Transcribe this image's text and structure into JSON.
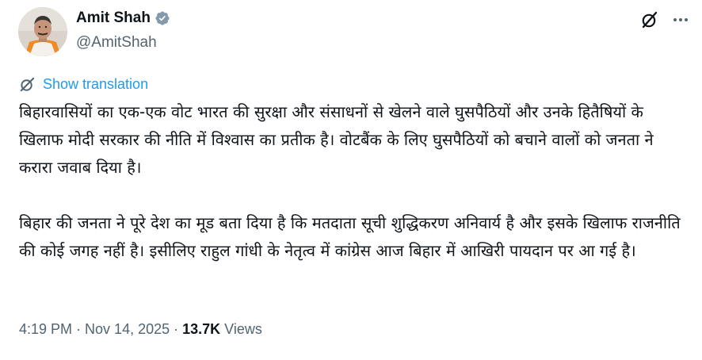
{
  "author": {
    "name": "Amit Shah",
    "handle": "@AmitShah",
    "avatar_icon": "profile-photo",
    "verified_icon": "verified-badge-icon",
    "verified_color": "#829aab"
  },
  "actions": {
    "grok_icon": "grok-icon",
    "more_icon": "more-horizontal-icon"
  },
  "translation": {
    "icon": "translate-icon",
    "label": "Show translation",
    "color": "#1d9bf0"
  },
  "tweet": {
    "paragraphs": [
      "बिहारवासियों का एक-एक वोट भारत की सुरक्षा और संसाधनों से खेलने वाले घुसपैठियों और उनके हितैषियों के खिलाफ मोदी सरकार की नीति में विश्वास का प्रतीक है। वोटबैंक के लिए घुसपैठियों को बचाने वालों को जनता ने करारा जवाब दिया है।",
      "बिहार की जनता ने पूरे देश का मूड बता दिया है कि मतदाता सूची शुद्धिकरण अनिवार्य है और इसके खिलाफ राजनीति की कोई जगह नहीं है। इसीलिए राहुल गांधी के नेतृत्व में कांग्रेस आज बिहार में आखिरी पायदान पर आ गई है।"
    ]
  },
  "meta": {
    "time": "4:19 PM",
    "separator": " · ",
    "date": "Nov 14, 2025",
    "views_count": "13.7K",
    "views_label": " Views"
  }
}
